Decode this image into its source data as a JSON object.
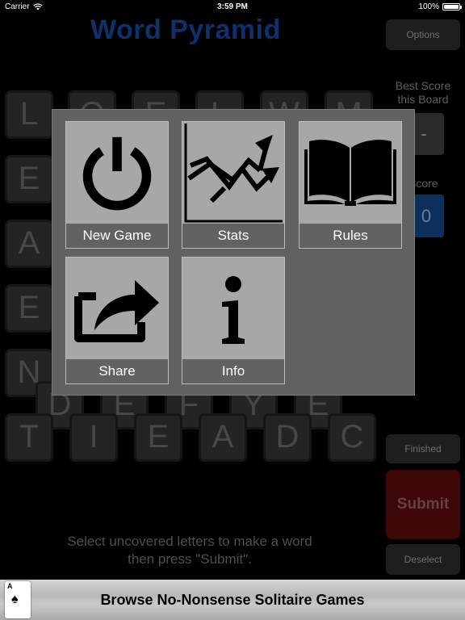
{
  "status_bar": {
    "carrier": "Carrier",
    "time": "3:59 PM",
    "battery": "100%"
  },
  "game": {
    "title": "Word Pyramid",
    "options_label": "Options",
    "best_score_label_line1": "Best Score",
    "best_score_label_line2": "this Board",
    "best_score_value": "-",
    "score_label": "Score",
    "score_value": "0",
    "finished_label": "Finished",
    "submit_label": "Submit",
    "deselect_label": "Deselect",
    "instructions_line1": "Select uncovered letters to make a word",
    "instructions_line2": "then press \"Submit\".",
    "tiles": {
      "row1": [
        "L",
        "O",
        "E",
        "L",
        "W",
        "M"
      ],
      "col_left": [
        "E",
        "A",
        "E",
        "N"
      ],
      "row_d": [
        "D",
        "E",
        "F",
        "Y",
        "E"
      ],
      "bottom": [
        "T",
        "I",
        "E",
        "A",
        "D",
        "C"
      ]
    }
  },
  "menu": {
    "items": [
      {
        "label": "New Game",
        "icon": "power-icon"
      },
      {
        "label": "Stats",
        "icon": "stats-chart-icon"
      },
      {
        "label": "Rules",
        "icon": "open-book-icon"
      },
      {
        "label": "Share",
        "icon": "share-icon"
      },
      {
        "label": "Info",
        "icon": "info-icon"
      }
    ]
  },
  "ad": {
    "card_rank": "A",
    "card_suit": "♠",
    "text": "Browse No-Nonsense Solitaire Games"
  },
  "colors": {
    "title": "#10306c",
    "submit": "#3e0708",
    "score_box": "#0c2f5c",
    "menu_panel": "#626262",
    "menu_tile": "#a7a7a7"
  }
}
